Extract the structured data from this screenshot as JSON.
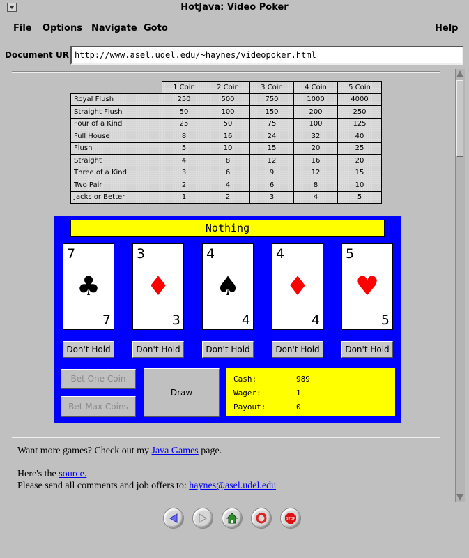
{
  "window": {
    "title": "HotJava: Video Poker"
  },
  "menubar": {
    "items": [
      "File",
      "Options",
      "Navigate",
      "Goto"
    ],
    "help": "Help"
  },
  "url": {
    "label": "Document URL:",
    "value": "http://www.asel.udel.edu/~haynes/videopoker.html"
  },
  "paytable": {
    "headers": [
      "1 Coin",
      "2 Coin",
      "3 Coin",
      "4 Coin",
      "5 Coin"
    ],
    "rows": [
      {
        "hand": "Royal Flush",
        "values": [
          "250",
          "500",
          "750",
          "1000",
          "4000"
        ]
      },
      {
        "hand": "Straight  Flush",
        "values": [
          "50",
          "100",
          "150",
          "200",
          "250"
        ]
      },
      {
        "hand": "Four of a Kind",
        "values": [
          "25",
          "50",
          "75",
          "100",
          "125"
        ]
      },
      {
        "hand": "Full House",
        "values": [
          "8",
          "16",
          "24",
          "32",
          "40"
        ]
      },
      {
        "hand": "Flush",
        "values": [
          "5",
          "10",
          "15",
          "20",
          "25"
        ]
      },
      {
        "hand": "Straight",
        "values": [
          "4",
          "8",
          "12",
          "16",
          "20"
        ]
      },
      {
        "hand": "Three of a Kind",
        "values": [
          "3",
          "6",
          "9",
          "12",
          "15"
        ]
      },
      {
        "hand": "Two  Pair",
        "values": [
          "2",
          "4",
          "6",
          "8",
          "10"
        ]
      },
      {
        "hand": "Jacks or Better",
        "values": [
          "1",
          "2",
          "3",
          "4",
          "5"
        ]
      }
    ]
  },
  "poker": {
    "result": "Nothing",
    "cards": [
      {
        "rank": "7",
        "suit": "♣",
        "color": "#000000"
      },
      {
        "rank": "3",
        "suit": "♦",
        "color": "#ff0000"
      },
      {
        "rank": "4",
        "suit": "♠",
        "color": "#000000"
      },
      {
        "rank": "4",
        "suit": "♦",
        "color": "#ff0000"
      },
      {
        "rank": "5",
        "suit": "♥",
        "color": "#ff0000"
      }
    ],
    "hold_label": "Don't Hold",
    "bet_one": "Bet One Coin",
    "bet_max": "Bet Max Coins",
    "draw": "Draw",
    "cash_label": "Cash:",
    "cash": "989",
    "wager_label": "Wager:",
    "wager": "1",
    "payout_label": "Payout:",
    "payout": "0",
    "colors": {
      "table": "#0000ff",
      "panel": "#ffff00"
    }
  },
  "footer": {
    "more_prefix": "Want more games? Check out my",
    "more_link": "Java Games",
    "more_suffix": "page.",
    "source_prefix": "Here's the",
    "source_link": "source.",
    "comments_prefix": "Please send all comments and job offers to:",
    "email": "haynes@asel.udel.edu"
  },
  "toolbar": {
    "buttons": [
      "back-icon",
      "forward-icon",
      "home-icon",
      "reload-icon",
      "stop-icon"
    ],
    "stop_label": "STOP"
  }
}
